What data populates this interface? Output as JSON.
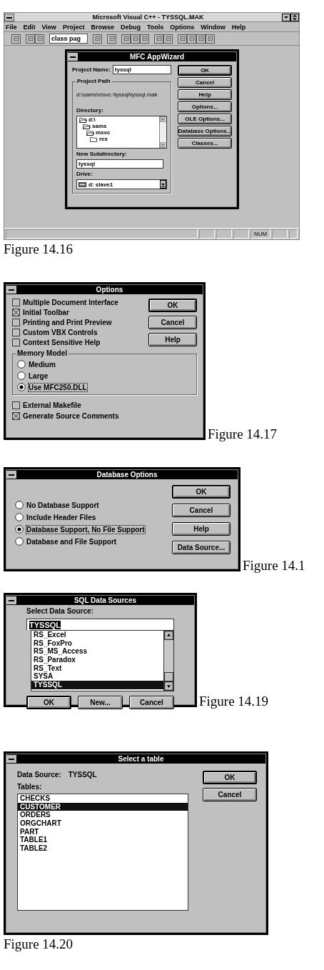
{
  "vcpp_window": {
    "title": "Microsoft Visual C++ - TYSSQL.MAK",
    "menu": [
      "File",
      "Edit",
      "View",
      "Project",
      "Browse",
      "Debug",
      "Tools",
      "Options",
      "Window",
      "Help"
    ],
    "toolbar_combo": "class pag",
    "wizard": {
      "title": "MFC AppWizard",
      "project_name_label": "Project Name:",
      "project_name": "tyssql",
      "group_label": "Project Path",
      "path": "d:\\sams\\msvc \\tyssql\\tyssql.mak",
      "directory_label": "Directory:",
      "directories": [
        {
          "name": "d:\\",
          "children": [
            {
              "name": "sams",
              "children": [
                {
                  "name": "msvc",
                  "children": [
                    {
                      "name": "res"
                    }
                  ]
                }
              ]
            }
          ]
        }
      ],
      "subdirectory_label": "New Subdirectory:",
      "subdirectory": "tyssql",
      "drive_label": "Drive:",
      "drive": "d: slave1",
      "buttons": [
        {
          "label": "OK",
          "default": true
        },
        {
          "label": "Cancel",
          "default": false
        },
        {
          "label": "Help",
          "default": false
        },
        {
          "label": "Options...",
          "default": false
        },
        {
          "label": "OLE Options...",
          "default": false
        },
        {
          "label": "Database Options...",
          "default": false
        },
        {
          "label": "Classes...",
          "default": false
        }
      ]
    },
    "status_indicator": "NUM",
    "caption": "Figure 14.16"
  },
  "options_dialog": {
    "title": "Options",
    "checkboxes": [
      {
        "label": "Multiple Document Interface",
        "checked": false
      },
      {
        "label": "Initial Toolbar",
        "checked": true
      },
      {
        "label": "Printing and Print Preview",
        "checked": false
      },
      {
        "label": "Custom VBX Controls",
        "checked": false
      },
      {
        "label": "Context Sensitive Help",
        "checked": false
      }
    ],
    "memory_model": {
      "label": "Memory Model",
      "options": [
        {
          "label": "Medium",
          "selected": false
        },
        {
          "label": "Large",
          "selected": false
        },
        {
          "label": "Use MFC250.DLL",
          "selected": true
        }
      ]
    },
    "bottom_checkboxes": [
      {
        "label": "External Makefile",
        "checked": false
      },
      {
        "label": "Generate Source Comments",
        "checked": true
      }
    ],
    "buttons": [
      {
        "label": "OK",
        "default": true
      },
      {
        "label": "Cancel",
        "default": false
      },
      {
        "label": "Help",
        "default": false
      }
    ],
    "caption": "Figure 14.17"
  },
  "database_options_dialog": {
    "title": "Database Options",
    "options": [
      {
        "label": "No Database Support",
        "selected": false
      },
      {
        "label": "Include Header Files",
        "selected": false
      },
      {
        "label": "Database Support, No File Support",
        "selected": true
      },
      {
        "label": "Database and File Support",
        "selected": false
      }
    ],
    "buttons": [
      {
        "label": "OK",
        "default": true
      },
      {
        "label": "Cancel",
        "default": false
      },
      {
        "label": "Help",
        "default": false
      },
      {
        "label": "Data Source...",
        "default": false
      }
    ],
    "caption": "Figure 14.1"
  },
  "sql_data_sources_dialog": {
    "title": "SQL Data Sources",
    "label": "Select Data Source:",
    "value": "TYSSQL",
    "items": [
      {
        "label": "RS_Excel",
        "selected": false
      },
      {
        "label": "RS_FoxPro",
        "selected": false
      },
      {
        "label": "RS_MS_Access",
        "selected": false
      },
      {
        "label": "RS_Paradox",
        "selected": false
      },
      {
        "label": "RS_Text",
        "selected": false
      },
      {
        "label": "SYSA",
        "selected": false
      },
      {
        "label": "TYSSQL",
        "selected": true
      }
    ],
    "buttons": [
      {
        "label": "OK",
        "default": true
      },
      {
        "label": "New...",
        "default": false
      },
      {
        "label": "Cancel",
        "default": false
      }
    ],
    "caption": "Figure 14.19"
  },
  "select_table_dialog": {
    "title": "Select a table",
    "data_source_label": "Data Source:",
    "data_source": "TYSSQL",
    "tables_label": "Tables:",
    "tables": [
      {
        "label": "CHECKS",
        "selected": false
      },
      {
        "label": "CUSTOMER",
        "selected": true
      },
      {
        "label": "ORDERS",
        "selected": false
      },
      {
        "label": "ORGCHART",
        "selected": false
      },
      {
        "label": "PART",
        "selected": false
      },
      {
        "label": "TABLE1",
        "selected": false
      },
      {
        "label": "TABLE2",
        "selected": false
      }
    ],
    "buttons": [
      {
        "label": "OK",
        "default": true
      },
      {
        "label": "Cancel",
        "default": false
      }
    ],
    "caption": "Figure 14.20"
  }
}
